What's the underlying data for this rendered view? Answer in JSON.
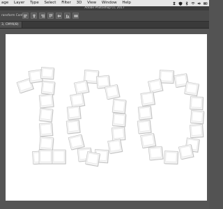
{
  "menu": {
    "items": [
      "age",
      "Layer",
      "Type",
      "Select",
      "Filter",
      "3D",
      "View",
      "Window",
      "Help"
    ]
  },
  "window": {
    "title": "Adobe Photoshop CC 2017"
  },
  "options_bar": {
    "label": "ransform Controls"
  },
  "document_tab": {
    "label": "3, CMYK/8)"
  },
  "icons": [
    "align-left-edges-icon",
    "align-horizontal-centers-icon",
    "align-right-edges-icon",
    "align-top-edges-icon",
    "align-vertical-centers-icon",
    "align-bottom-edges-icon",
    "distribute-icon"
  ],
  "colors": {
    "menubar": "#e6e6e6",
    "app_bg": "#535353",
    "canvas": "#ffffff",
    "photo_frame": "#f4f4f4"
  }
}
